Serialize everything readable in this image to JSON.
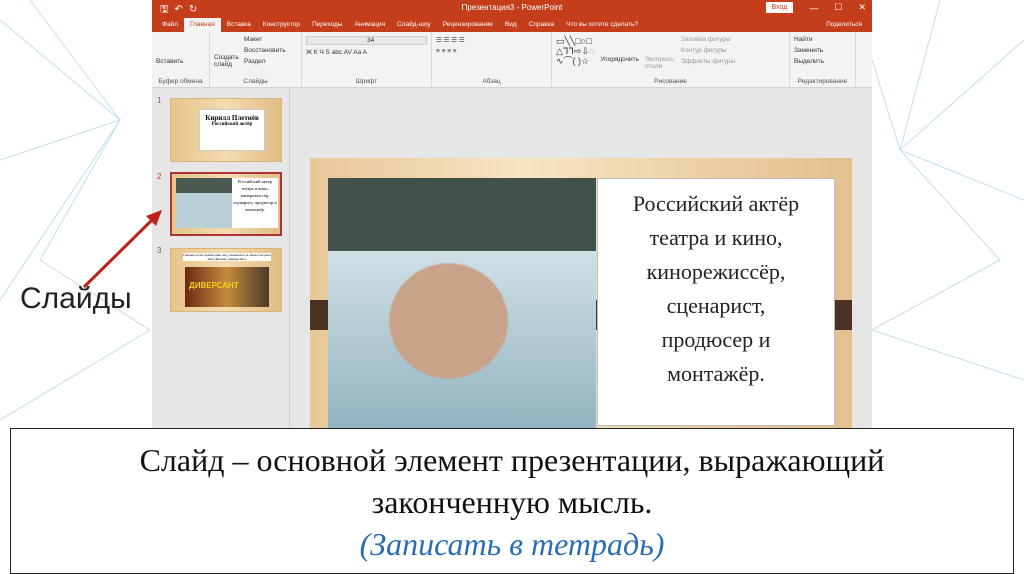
{
  "window": {
    "title": "Презентация3 - PowerPoint",
    "login": "Вход"
  },
  "tabs": [
    "Файл",
    "Главная",
    "Вставка",
    "Конструктор",
    "Переходы",
    "Анимация",
    "Слайд-шоу",
    "Рецензирование",
    "Вид",
    "Справка"
  ],
  "tell_me": "Что вы хотите сделать?",
  "share": "Поделиться",
  "ribbon": {
    "clipboard": {
      "paste": "Вставить",
      "label": "Буфер обмена"
    },
    "slides": {
      "new": "Создать слайд",
      "layout": "Макет",
      "reset": "Восстановить",
      "section": "Раздел",
      "label": "Слайды"
    },
    "font": {
      "size": "34",
      "label": "Шрифт"
    },
    "paragraph": {
      "label": "Абзац"
    },
    "drawing": {
      "arrange": "Упорядочить",
      "styles": "Экспресс-стили",
      "fill": "Заливка фигуры",
      "outline": "Контур фигуры",
      "effects": "Эффекты фигуры",
      "label": "Рисование"
    },
    "editing": {
      "find": "Найти",
      "replace": "Заменить",
      "select": "Выделить",
      "label": "Редактирование"
    }
  },
  "thumbnails": [
    {
      "num": "1",
      "title": "Кирилл Плетнёв",
      "subtitle": "Российский актёр"
    },
    {
      "num": "2",
      "text": "Российский актер театра и кино, кинорежиссёр, сценарист, продюсер и монтажёр."
    },
    {
      "num": "3",
      "text": "Первые роли, принесшие ему узнаваемость. Была сыграна им в фильме «Диверсант»",
      "poster": "ДИВЕРСАНТ"
    }
  ],
  "slide_text": "Российский актёр\nтеатра и кино,\nкинорежиссёр,\nсценарист,\nпродюсер и\nмонтажёр.",
  "side_label": "Слайды",
  "caption": {
    "main": "Слайд – основной элемент презентации, выражающий законченную мысль.",
    "note": "(Записать в тетрадь)"
  }
}
